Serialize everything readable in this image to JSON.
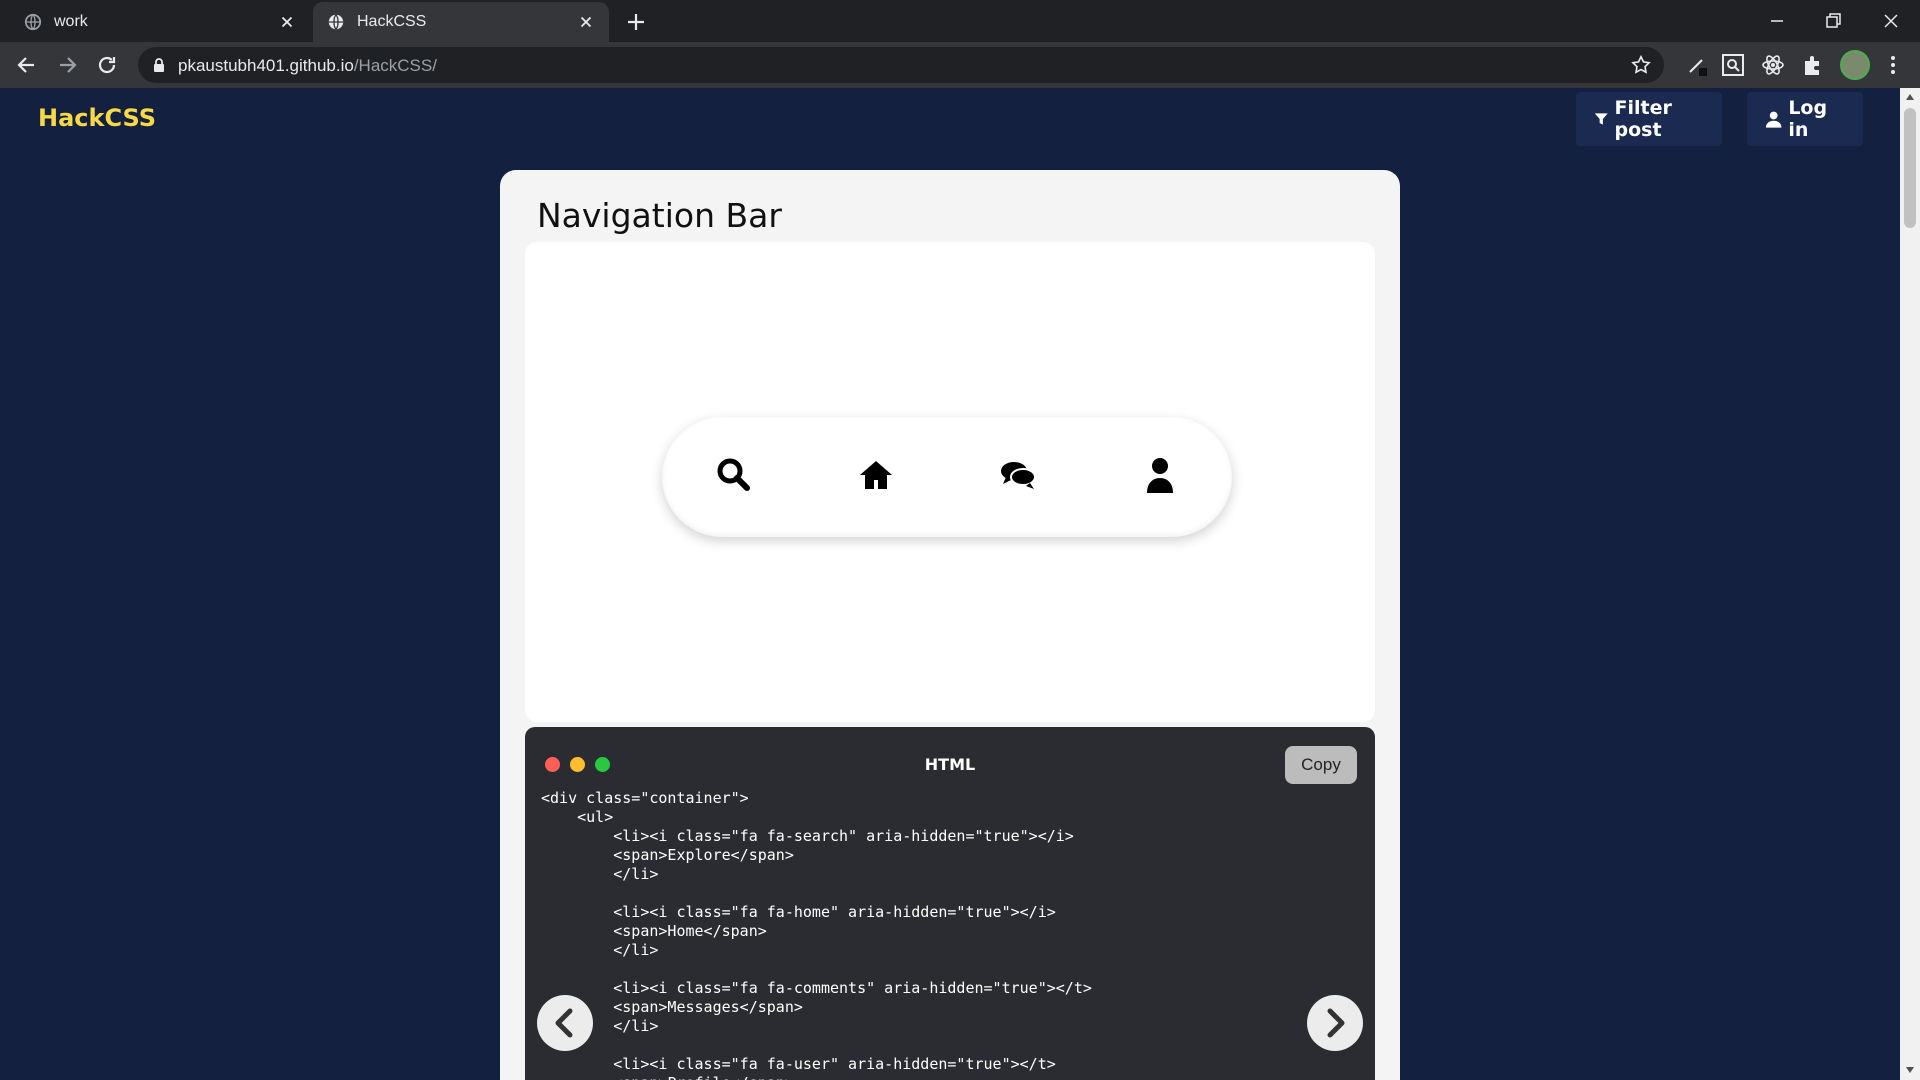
{
  "browser": {
    "tabs": [
      {
        "title": "work",
        "active": false
      },
      {
        "title": "HackCSS",
        "active": true
      }
    ],
    "url_host": "pkaustubh401.github.io",
    "url_path": "/HackCSS/"
  },
  "header": {
    "brand": "HackCSS",
    "filter_label": "Filter post",
    "login_label": "Log in"
  },
  "card": {
    "title": "Navigation Bar",
    "preview_icons": [
      "search-icon",
      "home-icon",
      "comments-icon",
      "user-icon"
    ],
    "code_panel": {
      "title": "HTML",
      "copy_label": "Copy",
      "code": "<div class=\"container\">\n    <ul>\n        <li><i class=\"fa fa-search\" aria-hidden=\"true\"></i>\n        <span>Explore</span>\n        </li>\n\n        <li><i class=\"fa fa-home\" aria-hidden=\"true\"></i>\n        <span>Home</span>\n        </li>\n\n        <li><i class=\"fa fa-comments\" aria-hidden=\"true\"></t>\n        <span>Messages</span>\n        </li>\n\n        <li><i class=\"fa fa-user\" aria-hidden=\"true\"></t>\n        <span>Profile</span>"
    }
  },
  "colors": {
    "page_bg": "#13203f",
    "brand": "#f7d948",
    "dot_red": "#ff5f57",
    "dot_yellow": "#febc2e",
    "dot_green": "#28c840"
  }
}
